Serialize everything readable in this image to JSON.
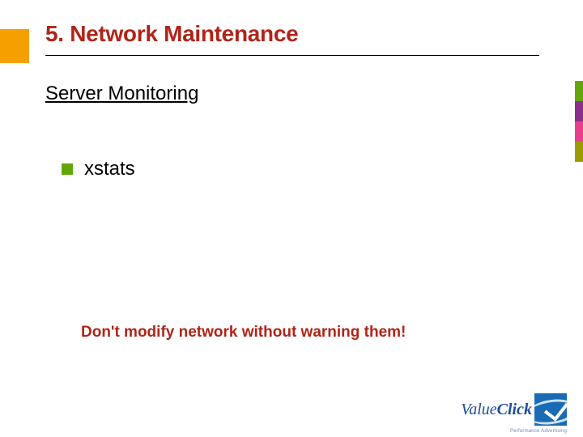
{
  "title": "5. Network Maintenance",
  "subtitle": "Server Monitoring",
  "bullets": [
    {
      "text": "xstats"
    }
  ],
  "warning": "Don't modify network without warning them!",
  "logo": {
    "value": "Value",
    "click": "Click",
    "tagline": "Performance Advertising"
  },
  "colors": {
    "accent_red": "#b02418",
    "bullet_green": "#63a60a",
    "deco_orange": "#f6a000",
    "logo_blue": "#1a6bb5"
  }
}
